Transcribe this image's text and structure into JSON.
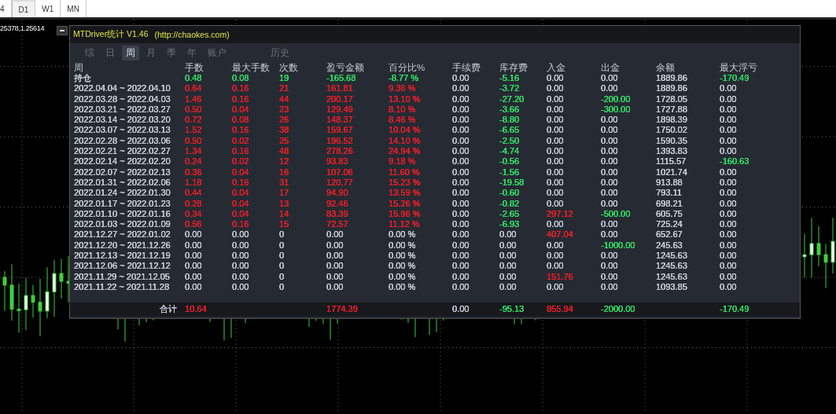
{
  "toolbar": {
    "timeframes": [
      {
        "label": "4",
        "selected": false
      },
      {
        "label": "D1",
        "selected": true
      },
      {
        "label": "W1",
        "selected": false
      },
      {
        "label": "MN",
        "selected": false
      }
    ]
  },
  "price_label": "25378,1.25614",
  "panel": {
    "title": "MTDriver统计 V1.46",
    "url": "(http://chaokes.com)",
    "tabs": [
      {
        "label": "综",
        "selected": false
      },
      {
        "label": "日",
        "selected": false
      },
      {
        "label": "周",
        "selected": true
      },
      {
        "label": "月",
        "selected": false
      },
      {
        "label": "季",
        "selected": false
      },
      {
        "label": "年",
        "selected": false
      },
      {
        "label": "账户",
        "selected": false
      },
      {
        "label": "历史",
        "selected": false
      }
    ],
    "table": {
      "period_heading": "周",
      "columns": [
        "手数",
        "最大手数",
        "次数",
        "盈亏金额",
        "百分比%",
        "手续费",
        "库存费",
        "入金",
        "出金",
        "余额",
        "最大浮亏"
      ],
      "rows": [
        {
          "period": "持仓",
          "cells": [
            {
              "text": "0.48",
              "color": "#33dd66"
            },
            {
              "text": "0.08",
              "color": "#33dd66"
            },
            {
              "text": "19",
              "color": "#33dd66"
            },
            {
              "text": "-165.68",
              "color": "#33dd66"
            },
            {
              "text": "-8.77 %",
              "color": "#33dd66"
            },
            {
              "text": "0.00"
            },
            {
              "text": "-5.16",
              "color": "#33dd66"
            },
            {
              "text": "0.00"
            },
            {
              "text": "0.00"
            },
            {
              "text": "1889.86"
            },
            {
              "text": "-170.49",
              "color": "#33dd66"
            }
          ]
        },
        {
          "period": "2022.04.04 ~ 2022.04.10",
          "cells": [
            {
              "text": "0.64",
              "color": "#e8202a"
            },
            {
              "text": "0.16",
              "color": "#e8202a"
            },
            {
              "text": "21",
              "color": "#e8202a"
            },
            {
              "text": "161.81",
              "color": "#e8202a"
            },
            {
              "text": "9.36 %",
              "color": "#e8202a"
            },
            {
              "text": "0.00"
            },
            {
              "text": "-3.72",
              "color": "#33dd66"
            },
            {
              "text": "0.00"
            },
            {
              "text": "0.00"
            },
            {
              "text": "1889.86"
            },
            {
              "text": "0.00"
            }
          ]
        },
        {
          "period": "2022.03.28 ~ 2022.04.03",
          "cells": [
            {
              "text": "1.46",
              "color": "#e8202a"
            },
            {
              "text": "0.16",
              "color": "#e8202a"
            },
            {
              "text": "44",
              "color": "#e8202a"
            },
            {
              "text": "200.17",
              "color": "#e8202a"
            },
            {
              "text": "13.10 %",
              "color": "#e8202a"
            },
            {
              "text": "0.00"
            },
            {
              "text": "-27.20",
              "color": "#33dd66"
            },
            {
              "text": "0.00"
            },
            {
              "text": "-200.00",
              "color": "#33dd66"
            },
            {
              "text": "1728.05"
            },
            {
              "text": "0.00"
            }
          ]
        },
        {
          "period": "2022.03.21 ~ 2022.03.27",
          "cells": [
            {
              "text": "0.50",
              "color": "#e8202a"
            },
            {
              "text": "0.04",
              "color": "#e8202a"
            },
            {
              "text": "23",
              "color": "#e8202a"
            },
            {
              "text": "129.49",
              "color": "#e8202a"
            },
            {
              "text": "8.10 %",
              "color": "#e8202a"
            },
            {
              "text": "0.00"
            },
            {
              "text": "-3.66",
              "color": "#33dd66"
            },
            {
              "text": "0.00"
            },
            {
              "text": "-300.00",
              "color": "#33dd66"
            },
            {
              "text": "1727.88"
            },
            {
              "text": "0.00"
            }
          ]
        },
        {
          "period": "2022.03.14 ~ 2022.03.20",
          "cells": [
            {
              "text": "0.72",
              "color": "#e8202a"
            },
            {
              "text": "0.08",
              "color": "#e8202a"
            },
            {
              "text": "26",
              "color": "#e8202a"
            },
            {
              "text": "148.37",
              "color": "#e8202a"
            },
            {
              "text": "8.46 %",
              "color": "#e8202a"
            },
            {
              "text": "0.00"
            },
            {
              "text": "-8.80",
              "color": "#33dd66"
            },
            {
              "text": "0.00"
            },
            {
              "text": "0.00"
            },
            {
              "text": "1898.39"
            },
            {
              "text": "0.00"
            }
          ]
        },
        {
          "period": "2022.03.07 ~ 2022.03.13",
          "cells": [
            {
              "text": "1.52",
              "color": "#e8202a"
            },
            {
              "text": "0.16",
              "color": "#e8202a"
            },
            {
              "text": "38",
              "color": "#e8202a"
            },
            {
              "text": "159.67",
              "color": "#e8202a"
            },
            {
              "text": "10.04 %",
              "color": "#e8202a"
            },
            {
              "text": "0.00"
            },
            {
              "text": "-6.65",
              "color": "#33dd66"
            },
            {
              "text": "0.00"
            },
            {
              "text": "0.00"
            },
            {
              "text": "1750.02"
            },
            {
              "text": "0.00"
            }
          ]
        },
        {
          "period": "2022.02.28 ~ 2022.03.06",
          "cells": [
            {
              "text": "0.50",
              "color": "#e8202a"
            },
            {
              "text": "0.02",
              "color": "#e8202a"
            },
            {
              "text": "25",
              "color": "#e8202a"
            },
            {
              "text": "196.52",
              "color": "#e8202a"
            },
            {
              "text": "14.10 %",
              "color": "#e8202a"
            },
            {
              "text": "0.00"
            },
            {
              "text": "-2.50",
              "color": "#33dd66"
            },
            {
              "text": "0.00"
            },
            {
              "text": "0.00"
            },
            {
              "text": "1590.35"
            },
            {
              "text": "0.00"
            }
          ]
        },
        {
          "period": "2022.02.21 ~ 2022.02.27",
          "cells": [
            {
              "text": "1.34",
              "color": "#e8202a"
            },
            {
              "text": "0.16",
              "color": "#e8202a"
            },
            {
              "text": "48",
              "color": "#e8202a"
            },
            {
              "text": "278.26",
              "color": "#e8202a"
            },
            {
              "text": "24.94 %",
              "color": "#e8202a"
            },
            {
              "text": "0.00"
            },
            {
              "text": "-4.74",
              "color": "#33dd66"
            },
            {
              "text": "0.00"
            },
            {
              "text": "0.00"
            },
            {
              "text": "1393.83"
            },
            {
              "text": "0.00"
            }
          ]
        },
        {
          "period": "2022.02.14 ~ 2022.02.20",
          "cells": [
            {
              "text": "0.24",
              "color": "#e8202a"
            },
            {
              "text": "0.02",
              "color": "#e8202a"
            },
            {
              "text": "12",
              "color": "#e8202a"
            },
            {
              "text": "93.83",
              "color": "#e8202a"
            },
            {
              "text": "9.18 %",
              "color": "#e8202a"
            },
            {
              "text": "0.00"
            },
            {
              "text": "-0.56",
              "color": "#33dd66"
            },
            {
              "text": "0.00"
            },
            {
              "text": "0.00"
            },
            {
              "text": "1115.57"
            },
            {
              "text": "-160.63",
              "color": "#33dd66"
            }
          ]
        },
        {
          "period": "2022.02.07 ~ 2022.02.13",
          "cells": [
            {
              "text": "0.36",
              "color": "#e8202a"
            },
            {
              "text": "0.04",
              "color": "#e8202a"
            },
            {
              "text": "16",
              "color": "#e8202a"
            },
            {
              "text": "107.06",
              "color": "#e8202a"
            },
            {
              "text": "11.60 %",
              "color": "#e8202a"
            },
            {
              "text": "0.00"
            },
            {
              "text": "-1.56",
              "color": "#33dd66"
            },
            {
              "text": "0.00"
            },
            {
              "text": "0.00"
            },
            {
              "text": "1021.74"
            },
            {
              "text": "0.00"
            }
          ]
        },
        {
          "period": "2022.01.31 ~ 2022.02.06",
          "cells": [
            {
              "text": "1.18",
              "color": "#e8202a"
            },
            {
              "text": "0.16",
              "color": "#e8202a"
            },
            {
              "text": "31",
              "color": "#e8202a"
            },
            {
              "text": "120.77",
              "color": "#e8202a"
            },
            {
              "text": "15.23 %",
              "color": "#e8202a"
            },
            {
              "text": "0.00"
            },
            {
              "text": "-19.58",
              "color": "#33dd66"
            },
            {
              "text": "0.00"
            },
            {
              "text": "0.00"
            },
            {
              "text": "913.88"
            },
            {
              "text": "0.00"
            }
          ]
        },
        {
          "period": "2022.01.24 ~ 2022.01.30",
          "cells": [
            {
              "text": "0.44",
              "color": "#e8202a"
            },
            {
              "text": "0.04",
              "color": "#e8202a"
            },
            {
              "text": "17",
              "color": "#e8202a"
            },
            {
              "text": "94.90",
              "color": "#e8202a"
            },
            {
              "text": "13.59 %",
              "color": "#e8202a"
            },
            {
              "text": "0.00"
            },
            {
              "text": "-0.60",
              "color": "#33dd66"
            },
            {
              "text": "0.00"
            },
            {
              "text": "0.00"
            },
            {
              "text": "793.11"
            },
            {
              "text": "0.00"
            }
          ]
        },
        {
          "period": "2022.01.17 ~ 2022.01.23",
          "cells": [
            {
              "text": "0.28",
              "color": "#e8202a"
            },
            {
              "text": "0.04",
              "color": "#e8202a"
            },
            {
              "text": "13",
              "color": "#e8202a"
            },
            {
              "text": "92.46",
              "color": "#e8202a"
            },
            {
              "text": "15.26 %",
              "color": "#e8202a"
            },
            {
              "text": "0.00"
            },
            {
              "text": "-0.82",
              "color": "#33dd66"
            },
            {
              "text": "0.00"
            },
            {
              "text": "0.00"
            },
            {
              "text": "698.21"
            },
            {
              "text": "0.00"
            }
          ]
        },
        {
          "period": "2022.01.10 ~ 2022.01.16",
          "cells": [
            {
              "text": "0.34",
              "color": "#e8202a"
            },
            {
              "text": "0.04",
              "color": "#e8202a"
            },
            {
              "text": "14",
              "color": "#e8202a"
            },
            {
              "text": "83.39",
              "color": "#e8202a"
            },
            {
              "text": "15.96 %",
              "color": "#e8202a"
            },
            {
              "text": "0.00"
            },
            {
              "text": "-2.65",
              "color": "#33dd66"
            },
            {
              "text": "297.12",
              "color": "#e8202a"
            },
            {
              "text": "-500.00",
              "color": "#33dd66"
            },
            {
              "text": "605.75"
            },
            {
              "text": "0.00"
            }
          ]
        },
        {
          "period": "2022.01.03 ~ 2022.01.09",
          "cells": [
            {
              "text": "0.56",
              "color": "#e8202a"
            },
            {
              "text": "0.16",
              "color": "#e8202a"
            },
            {
              "text": "15",
              "color": "#e8202a"
            },
            {
              "text": "72.57",
              "color": "#e8202a"
            },
            {
              "text": "11.12 %",
              "color": "#e8202a"
            },
            {
              "text": "0.00"
            },
            {
              "text": "-6.93",
              "color": "#33dd66"
            },
            {
              "text": "0.00"
            },
            {
              "text": "0.00"
            },
            {
              "text": "725.24"
            },
            {
              "text": "0.00"
            }
          ]
        },
        {
          "period": "2021.12.27 ~ 2022.01.02",
          "cells": [
            {
              "text": "0.00"
            },
            {
              "text": "0.00"
            },
            {
              "text": "0"
            },
            {
              "text": "0.00"
            },
            {
              "text": "0.00 %"
            },
            {
              "text": "0.00"
            },
            {
              "text": "0.00"
            },
            {
              "text": "407.04",
              "color": "#e8202a"
            },
            {
              "text": "0.00"
            },
            {
              "text": "652.67"
            },
            {
              "text": "0.00"
            }
          ]
        },
        {
          "period": "2021.12.20 ~ 2021.12.26",
          "cells": [
            {
              "text": "0.00"
            },
            {
              "text": "0.00"
            },
            {
              "text": "0"
            },
            {
              "text": "0.00"
            },
            {
              "text": "0.00 %"
            },
            {
              "text": "0.00"
            },
            {
              "text": "0.00"
            },
            {
              "text": "0.00"
            },
            {
              "text": "-1000.00",
              "color": "#33dd66"
            },
            {
              "text": "245.63"
            },
            {
              "text": "0.00"
            }
          ]
        },
        {
          "period": "2021.12.13 ~ 2021.12.19",
          "cells": [
            {
              "text": "0.00"
            },
            {
              "text": "0.00"
            },
            {
              "text": "0"
            },
            {
              "text": "0.00"
            },
            {
              "text": "0.00 %"
            },
            {
              "text": "0.00"
            },
            {
              "text": "0.00"
            },
            {
              "text": "0.00"
            },
            {
              "text": "0.00"
            },
            {
              "text": "1245.63"
            },
            {
              "text": "0.00"
            }
          ]
        },
        {
          "period": "2021.12.06 ~ 2021.12.12",
          "cells": [
            {
              "text": "0.00"
            },
            {
              "text": "0.00"
            },
            {
              "text": "0"
            },
            {
              "text": "0.00"
            },
            {
              "text": "0.00 %"
            },
            {
              "text": "0.00"
            },
            {
              "text": "0.00"
            },
            {
              "text": "0.00"
            },
            {
              "text": "0.00"
            },
            {
              "text": "1245.63"
            },
            {
              "text": "0.00"
            }
          ]
        },
        {
          "period": "2021.11.29 ~ 2021.12.05",
          "cells": [
            {
              "text": "0.00"
            },
            {
              "text": "0.00"
            },
            {
              "text": "0"
            },
            {
              "text": "0.00"
            },
            {
              "text": "0.00 %"
            },
            {
              "text": "0.00"
            },
            {
              "text": "0.00"
            },
            {
              "text": "151.76",
              "color": "#e8202a"
            },
            {
              "text": "0.00"
            },
            {
              "text": "1245.63"
            },
            {
              "text": "0.00"
            }
          ]
        },
        {
          "period": "2021.11.22 ~ 2021.11.28",
          "cells": [
            {
              "text": "0.00"
            },
            {
              "text": "0.00"
            },
            {
              "text": "0"
            },
            {
              "text": "0.00"
            },
            {
              "text": "0.00 %"
            },
            {
              "text": "0.00"
            },
            {
              "text": "0.00"
            },
            {
              "text": "0.00"
            },
            {
              "text": "0.00"
            },
            {
              "text": "1093.85"
            },
            {
              "text": "0.00"
            }
          ]
        }
      ],
      "total": {
        "label": "合计",
        "cells": [
          {
            "text": "10.64",
            "color": "#e8202a"
          },
          null,
          null,
          {
            "text": "1774.39",
            "color": "#e8202a"
          },
          null,
          {
            "text": "0.00"
          },
          {
            "text": "-95.13",
            "color": "#33dd66"
          },
          {
            "text": "855.94",
            "color": "#e8202a"
          },
          {
            "text": "-2000.00",
            "color": "#33dd66"
          },
          null,
          {
            "text": "-170.49",
            "color": "#33dd66"
          }
        ]
      }
    }
  }
}
